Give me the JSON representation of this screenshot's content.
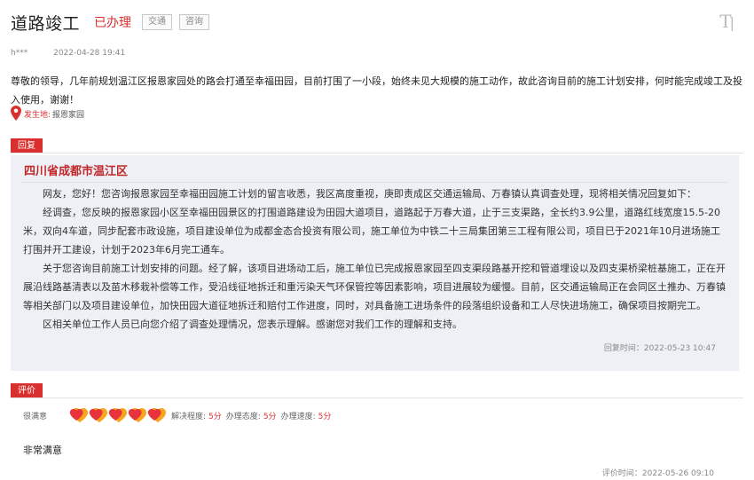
{
  "header": {
    "title": "道路竣工",
    "status": "已办理",
    "tags": [
      "交通",
      "咨询"
    ],
    "font_size_icon": "TI"
  },
  "meta": {
    "user": "h***",
    "date": "2022-04-28 19:41"
  },
  "content": "尊敬的领导，几年前规划温江区报恩家园处的路会打通至幸福田园，目前打围了一小段，始终未见大规模的施工动作，故此咨询目前的施工计划安排，何时能完成竣工及投入使用，谢谢！",
  "location": {
    "icon": "map-pin-icon",
    "label": "发生地:",
    "value": "报恩家园"
  },
  "reply": {
    "tag": "回复",
    "org": "四川省成都市温江区",
    "paragraphs": [
      "网友，您好！您咨询报恩家园至幸福田园施工计划的留言收悉，我区高度重视，庚即责成区交通运输局、万春镇认真调查处理，现将相关情况回复如下：",
      "经调查，您反映的报恩家园小区至幸福田园景区的打围道路建设为田园大道项目，道路起于万春大道，止于三支渠路，全长约3.9公里，道路红线宽度15.5-20米，双向4车道，同步配套市政设施，项目建设单位为成都金态合投资有限公司，施工单位为中铁二十三局集团第三工程有限公司，项目已于2021年10月进场施工打围并开工建设，计划于2023年6月完工通车。",
      "关于您咨询目前施工计划安排的问题。经了解，该项目进场动工后，施工单位已完成报恩家园至四支渠段路基开挖和管道埋设以及四支渠桥梁桩基施工，正在开展沿线路基清表以及苗木移栽补偿等工作，受沿线征地拆迁和重污染天气环保管控等因素影响，项目进展较为缓慢。目前，区交通运输局正在会同区土推办、万春镇等相关部门以及项目建设单位，加快田园大道征地拆迁和赔付工作进度，同时，对具备施工进场条件的段落组织设备和工人尽快进场施工，确保项目按期完工。",
      "区相关单位工作人员已向您介绍了调查处理情况，您表示理解。感谢您对我们工作的理解和支持。"
    ],
    "time": "回复时间：2022-05-23 10:47"
  },
  "evaluation": {
    "tag": "评价",
    "label": "很满意",
    "hearts": 5,
    "heart_colors": [
      "#e8323c",
      "#f7a51c"
    ],
    "scores": [
      {
        "label": "解决程度:",
        "value": "5分"
      },
      {
        "label": "办理态度:",
        "value": "5分"
      },
      {
        "label": "办理速度:",
        "value": "5分"
      }
    ],
    "comment": "非常满意",
    "time": "评价时间：2022-05-26 09:10"
  }
}
